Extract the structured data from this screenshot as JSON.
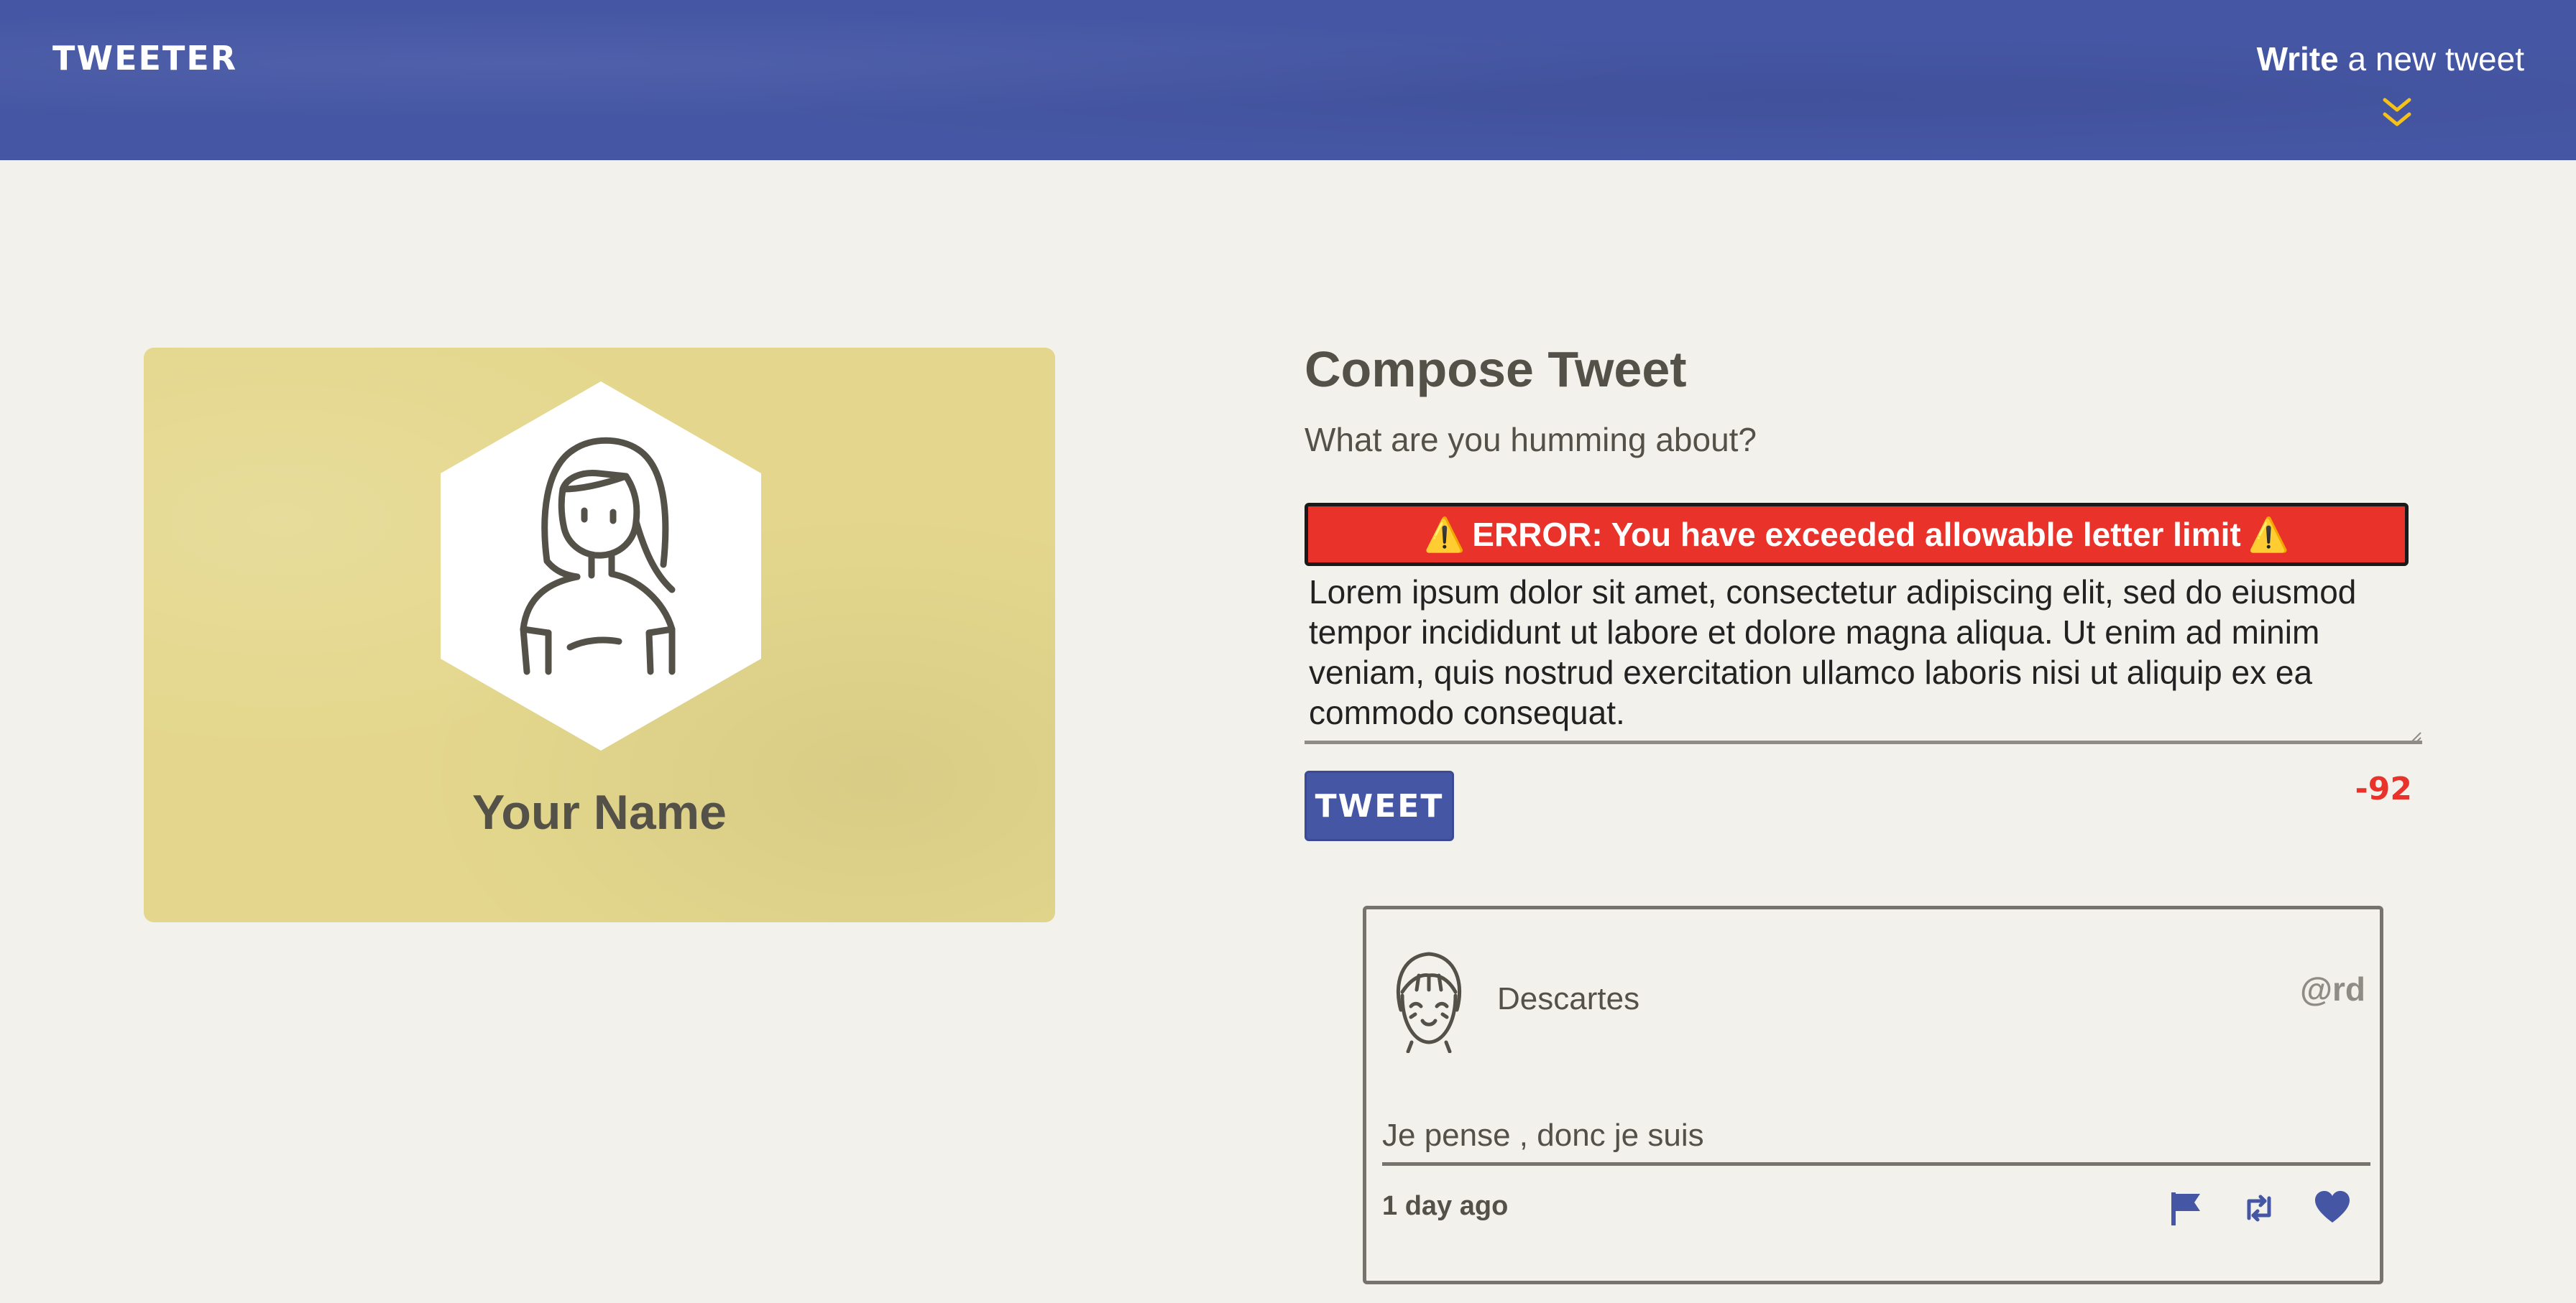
{
  "nav": {
    "brand": "TWEETER",
    "write_strong": "Write",
    "write_rest": "a new tweet",
    "chevron_icon": "double-chevron-down-icon"
  },
  "profile": {
    "name": "Your Name",
    "avatar_icon": "female-avatar-icon"
  },
  "compose": {
    "title": "Compose Tweet",
    "subtitle": "What are you humming about?",
    "error_message": "ERROR: You have exceeded allowable letter limit",
    "warning_glyph": "⚠️",
    "tweet_text": "Lorem ipsum dolor sit amet, consectetur adipiscing elit, sed do eiusmod tempor incididunt ut labore et dolore magna aliqua. Ut enim ad minim veniam, quis nostrud exercitation ullamco laboris nisi ut aliquip ex ea commodo consequat.",
    "tweet_button": "TWEET",
    "counter": "-92"
  },
  "tweet": {
    "author": "Descartes",
    "handle": "@rd",
    "content": "Je pense , donc je suis",
    "time": "1 day ago",
    "actions": [
      "flag-icon",
      "retweet-icon",
      "heart-icon"
    ]
  },
  "colors": {
    "nav": "#4556a4",
    "background": "#f3f1eb",
    "card": "#e4d78d",
    "error": "#e8322a",
    "accent_yellow": "#f6c21a",
    "text": "#545149"
  }
}
